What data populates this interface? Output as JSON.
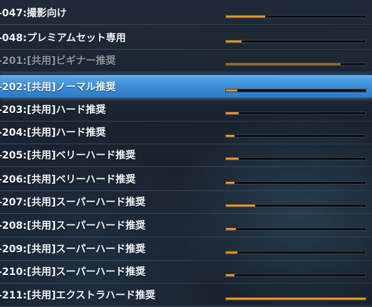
{
  "items": [
    {
      "label": "-047:撮影向け",
      "progress": 0.28,
      "selected": false,
      "disabled": false
    },
    {
      "label": "-048:プレミアムセット専用",
      "progress": 0.11,
      "selected": false,
      "disabled": false
    },
    {
      "label": "-201:[共用]ビギナー推奨",
      "progress": 0.82,
      "selected": false,
      "disabled": true
    },
    {
      "label": "-202:[共用]ノーマル推奨",
      "progress": 0.08,
      "selected": true,
      "disabled": false
    },
    {
      "label": "-203:[共用]ハード推奨",
      "progress": 0.09,
      "selected": false,
      "disabled": false
    },
    {
      "label": "-204:[共用]ハード推奨",
      "progress": 0.06,
      "selected": false,
      "disabled": false
    },
    {
      "label": "-205:[共用]ベリーハード推奨",
      "progress": 0.09,
      "selected": false,
      "disabled": false
    },
    {
      "label": "-206:[共用]ベリーハード推奨",
      "progress": 0.06,
      "selected": false,
      "disabled": false
    },
    {
      "label": "-207:[共用]スーパーハード推奨",
      "progress": 0.21,
      "selected": false,
      "disabled": false
    },
    {
      "label": "-208:[共用]スーパーハード推奨",
      "progress": 0.07,
      "selected": false,
      "disabled": false
    },
    {
      "label": "-209:[共用]スーパーハード推奨",
      "progress": 0.08,
      "selected": false,
      "disabled": false
    },
    {
      "label": "-210:[共用]スーパーハード推奨",
      "progress": 0.06,
      "selected": false,
      "disabled": false
    },
    {
      "label": "-211:[共用]エクストラハード推奨",
      "progress": 1.0,
      "selected": false,
      "disabled": false
    }
  ]
}
